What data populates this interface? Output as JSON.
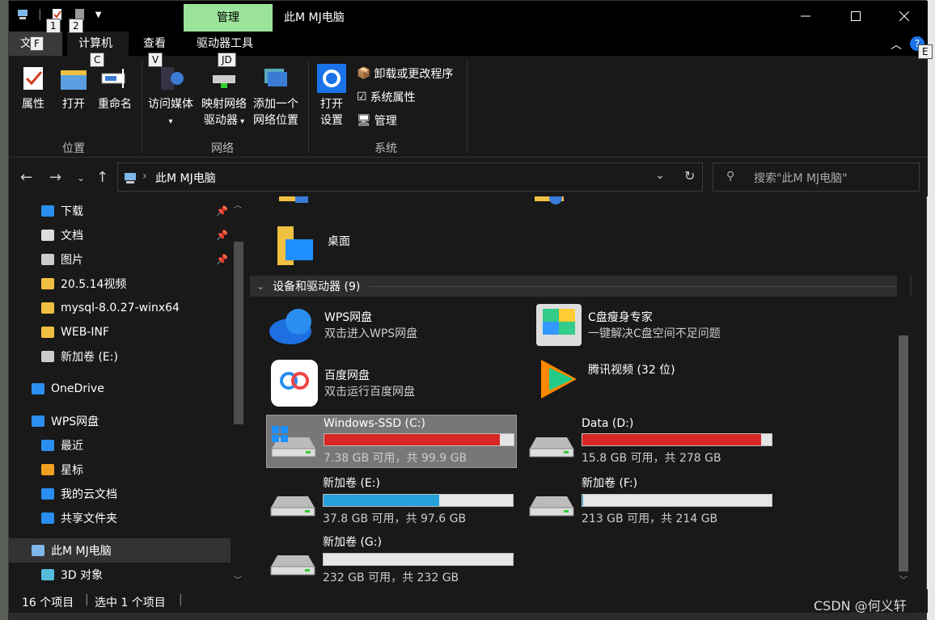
{
  "window": {
    "title": "此M  MJ电脑"
  },
  "qat": {
    "keytip1": "1",
    "keytip2": "2"
  },
  "context_tab": {
    "label": "管理"
  },
  "tabs": [
    {
      "label": "文件",
      "keytip": "F"
    },
    {
      "label": "计算机",
      "keytip": "C"
    },
    {
      "label": "查看",
      "keytip": "V"
    },
    {
      "label": "驱动器工具",
      "keytip": "JD"
    }
  ],
  "help_keytip": "E",
  "ribbon": {
    "location": {
      "group": "位置",
      "buttons": [
        "属性",
        "打开",
        "重命名"
      ]
    },
    "network": {
      "group": "网络",
      "media_l1": "访问媒体",
      "map_l1": "映射网络",
      "map_l2": "驱动器",
      "add_l1": "添加一个",
      "add_l2": "网络位置"
    },
    "system": {
      "group": "系统",
      "settings_l1": "打开",
      "settings_l2": "设置",
      "uninstall": "卸载或更改程序",
      "sysprops": "系统属性",
      "manage": "管理"
    }
  },
  "address": {
    "path": "此M  MJ电脑",
    "search_placeholder": "搜索\"此M  MJ电脑\""
  },
  "sidebar": {
    "items": [
      {
        "label": "下载",
        "icon": "download-icon",
        "pinned": true
      },
      {
        "label": "文档",
        "icon": "document-icon",
        "pinned": true
      },
      {
        "label": "图片",
        "icon": "pictures-icon",
        "pinned": true
      },
      {
        "label": "20.5.14视频",
        "icon": "folder-icon"
      },
      {
        "label": "mysql-8.0.27-winx64",
        "icon": "folder-icon"
      },
      {
        "label": "WEB-INF",
        "icon": "folder-icon"
      },
      {
        "label": "新加卷 (E:)",
        "icon": "drive-icon"
      },
      {
        "label": "OneDrive",
        "icon": "onedrive-icon"
      },
      {
        "label": "WPS网盘",
        "icon": "wps-cloud-icon"
      },
      {
        "label": "最近",
        "icon": "recent-icon"
      },
      {
        "label": "星标",
        "icon": "star-icon"
      },
      {
        "label": "我的云文档",
        "icon": "cloud-docs-icon"
      },
      {
        "label": "共享文件夹",
        "icon": "shared-icon"
      },
      {
        "label": "此M  MJ电脑",
        "icon": "this-pc-icon",
        "selected": true
      },
      {
        "label": "3D 对象",
        "icon": "3d-objects-icon"
      }
    ]
  },
  "main": {
    "desktop_label": "桌面",
    "group_header": "设备和驱动器 (9)",
    "apps": [
      {
        "name": "WPS网盘",
        "desc": "双击进入WPS网盘"
      },
      {
        "name": "C盘瘦身专家",
        "desc": "一键解决C盘空间不足问题"
      },
      {
        "name": "百度网盘",
        "desc": "双击运行百度网盘"
      },
      {
        "name": "腾讯视频 (32 位)",
        "desc": ""
      }
    ],
    "drives": [
      {
        "name": "Windows-SSD (C:)",
        "info": "7.38 GB 可用，共 99.9 GB",
        "used_fraction": 0.926,
        "color": "#da2626"
      },
      {
        "name": "Data (D:)",
        "info": "15.8 GB 可用，共 278 GB",
        "used_fraction": 0.943,
        "color": "#da2626"
      },
      {
        "name": "新加卷 (E:)",
        "info": "37.8 GB 可用，共 97.6 GB",
        "used_fraction": 0.613,
        "color": "#26a0da"
      },
      {
        "name": "新加卷 (F:)",
        "info": "213 GB 可用，共 214 GB",
        "used_fraction": 0.005,
        "color": "#26a0da"
      },
      {
        "name": "新加卷 (G:)",
        "info": "232 GB 可用，共 232 GB",
        "used_fraction": 0.0,
        "color": "#26a0da"
      }
    ]
  },
  "status": {
    "count": "16 个项目",
    "selected": "选中 1 个项目"
  },
  "watermark": "CSDN @何义轩"
}
